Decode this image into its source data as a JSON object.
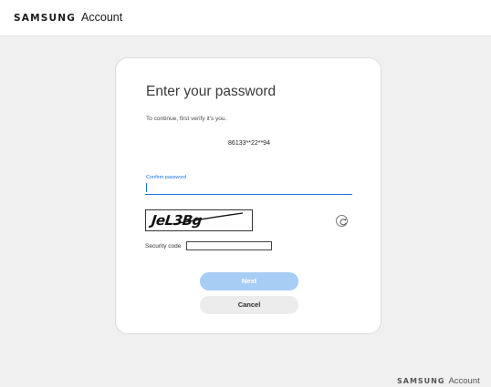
{
  "header": {
    "logo_text": "SAMSUNG",
    "account_text": "Account"
  },
  "card": {
    "title": "Enter your password",
    "subtitle": "To continue, first verify it's you.",
    "account_id": "86133**22**94",
    "password": {
      "label": "Confirm password",
      "value": "",
      "placeholder": ""
    },
    "captcha": {
      "text": "JeL3Bg",
      "refresh_icon": "refresh-icon"
    },
    "security_code": {
      "label": "Security code",
      "value": ""
    },
    "next_label": "Next",
    "cancel_label": "Cancel"
  },
  "footer": {
    "logo_text": "SAMSUNG",
    "account_text": "Account"
  },
  "colors": {
    "accent": "#1a73e8",
    "next_button_disabled": "#a8cdf5",
    "cancel_button": "#ececec",
    "page_background": "#f0f0f0"
  }
}
